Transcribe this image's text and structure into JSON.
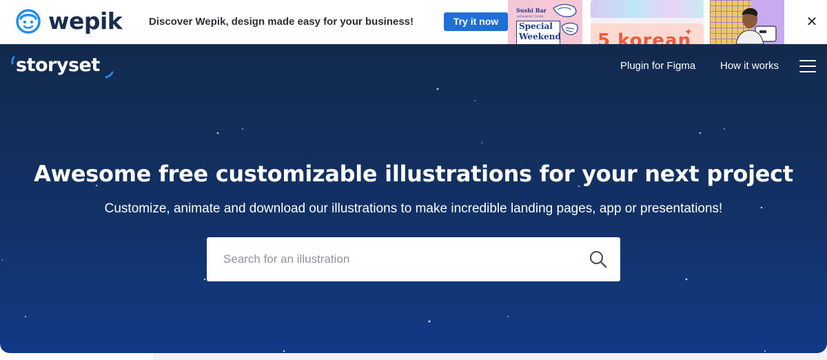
{
  "banner": {
    "brand": "wepik",
    "text": "Discover Wepik, design made easy for your business!",
    "cta_label": "Try it now",
    "close_glyph": "✕",
    "promo_cards": {
      "sushi_small": "Sushi Bar",
      "sushi_tiny": "JAPANESE FOOD",
      "special_line1": "Special",
      "special_line2": "Weekend",
      "korean_text": "5 korean"
    }
  },
  "header": {
    "logo": "storyset",
    "nav": {
      "figma": "Plugin for Figma",
      "how": "How it works"
    },
    "menu_icon": "hamburger-menu-icon"
  },
  "hero": {
    "title": "Awesome free customizable illustrations for your next project",
    "subtitle": "Customize, animate and download our illustrations to make incredible landing pages, app or presentations!",
    "search": {
      "placeholder": "Search for an illustration",
      "value": "",
      "icon": "search-icon"
    }
  },
  "colors": {
    "hero_top": "#132a4d",
    "hero_bottom": "#113a86",
    "cta_blue": "#1f6fd6",
    "logo_accent": "#1e8cf0"
  }
}
